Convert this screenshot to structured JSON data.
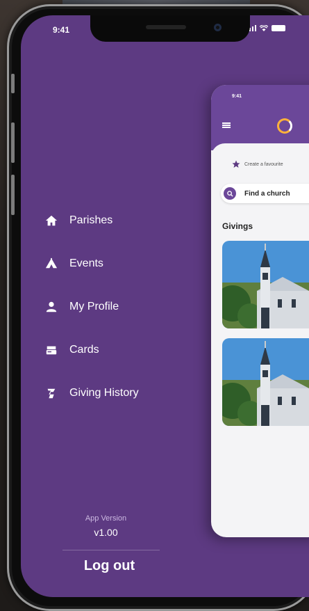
{
  "status_bar": {
    "time": "9:41"
  },
  "drawer": {
    "menu": [
      {
        "label": "Parishes",
        "icon": "home-icon"
      },
      {
        "label": "Events",
        "icon": "tent-icon"
      },
      {
        "label": "My Profile",
        "icon": "person-icon"
      },
      {
        "label": "Cards",
        "icon": "card-icon"
      },
      {
        "label": "Giving History",
        "icon": "history-icon"
      }
    ],
    "version_label": "App Version",
    "version_value": "v1.00",
    "logout_label": "Log out"
  },
  "preview": {
    "time": "9:41",
    "favourite_text": "Create a favourite",
    "search_placeholder": "Find a church",
    "section_title": "Givings"
  },
  "colors": {
    "drawer_bg": "#5d3a82",
    "header_purple": "#6b4799",
    "logo_accent": "#ffb23a"
  }
}
